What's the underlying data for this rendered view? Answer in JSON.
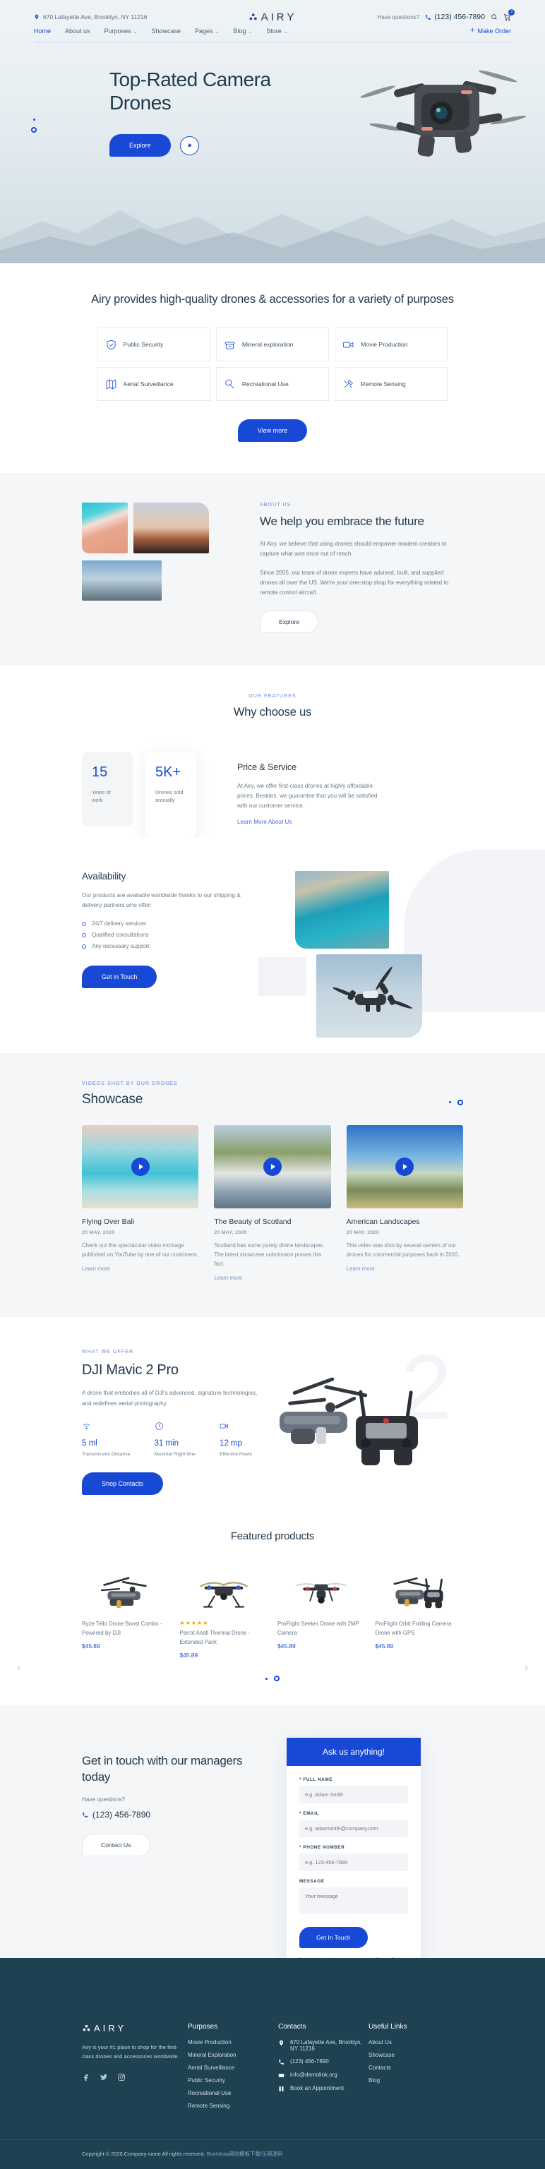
{
  "header": {
    "address": "670 Lafayette Ave, Brooklyn, NY 11216",
    "brand": "AIRY",
    "have_questions": "Have questions?",
    "phone": "(123) 456-7890",
    "cart_count": "3",
    "nav": [
      {
        "label": "Home",
        "caret": false,
        "active": true
      },
      {
        "label": "About us",
        "caret": false,
        "active": false
      },
      {
        "label": "Purposes",
        "caret": true,
        "active": false
      },
      {
        "label": "Showcase",
        "caret": false,
        "active": false
      },
      {
        "label": "Pages",
        "caret": true,
        "active": false
      },
      {
        "label": "Blog",
        "caret": true,
        "active": false
      },
      {
        "label": "Store",
        "caret": true,
        "active": false
      }
    ],
    "make_order": "Make Order"
  },
  "hero": {
    "title": "Top-Rated Camera Drones",
    "explore": "Explore"
  },
  "purposes": {
    "heading": "Airy provides high-quality drones & accessories for a variety of purposes",
    "cards": [
      {
        "label": "Public Security",
        "icon": "shield-icon"
      },
      {
        "label": "Mineral exploration",
        "icon": "mine-icon"
      },
      {
        "label": "Movie Production",
        "icon": "video-camera-icon"
      },
      {
        "label": "Aerial Surveillance",
        "icon": "map-icon"
      },
      {
        "label": "Recreational Use",
        "icon": "racket-icon"
      },
      {
        "label": "Remote Sensing",
        "icon": "tools-icon"
      }
    ],
    "view_more": "View more"
  },
  "about": {
    "eyebrow": "ABOUT US",
    "title": "We help you embrace the future",
    "p1": "At Airy, we believe that using drones should empower modern creators to capture what was once out of reach.",
    "p2": "Since 2005, our team of drone experts have advised, built, and supplied drones all over the US. We're your one-stop shop for everything related to remote control aircraft.",
    "explore": "Explore"
  },
  "features": {
    "eyebrow": "OUR FEATURES",
    "title": "Why choose us",
    "stats": [
      {
        "num": "15",
        "label": "Years of work"
      },
      {
        "num": "5K+",
        "label": "Drones sold annually"
      }
    ],
    "price_title": "Price & Service",
    "price_text": "At Airy, we offer first-class drones at highly affordable prices. Besides, we guarantee that you will be satisfied with our customer service.",
    "price_link": "Learn More About Us"
  },
  "availability": {
    "title": "Availability",
    "text": "Our products are available worldwide thanks to our shipping & delivery partners who offer:",
    "items": [
      "24/7 delivery services",
      "Qualified consultations",
      "Any necessary support"
    ],
    "cta": "Get in Touch"
  },
  "showcase": {
    "eyebrow": "VIDEOS SHOT BY OUR DRONES",
    "title": "Showcase",
    "videos": [
      {
        "title": "Flying Over Bali",
        "date": "20 MAY, 2020",
        "desc": "Check out this spectacular video montage published on YouTube by one of our customers.",
        "link": "Learn more"
      },
      {
        "title": "The Beauty of Scotland",
        "date": "20 MAY, 2020",
        "desc": "Scotland has some purely divine landscapes. The latest showcase submission proves this fact.",
        "link": "Learn more"
      },
      {
        "title": "American Landscapes",
        "date": "20 MAY, 2020",
        "desc": "This video was shot by several owners of our drones for commercial purposes back in 2010.",
        "link": "Learn more"
      }
    ]
  },
  "offer": {
    "eyebrow": "WHAT WE OFFER",
    "title": "DJI Mavic 2 Pro",
    "text": "A drone that embodies all of DJI's advanced, signature technologies, and redefines aerial photography.",
    "specs": [
      {
        "num": "5 ml",
        "label": "Transmission Distance",
        "icon": "signal-icon"
      },
      {
        "num": "31 min",
        "label": "Maximal Flight time",
        "icon": "clock-icon"
      },
      {
        "num": "12 mp",
        "label": "Effective Pixels",
        "icon": "video-camera-icon"
      }
    ],
    "cta": "Shop Contacts",
    "watermark": "2"
  },
  "products": {
    "title": "Featured products",
    "items": [
      {
        "name": "Ryze Tello Drone Boost Combo - Powered by DJI",
        "price": "$45.89",
        "stars": 0
      },
      {
        "name": "Parrot Anafi Thermal Drone - Extended Pack",
        "price": "$45.89",
        "stars": 5
      },
      {
        "name": "ProFlight Seeker Drone with 2MP Camera",
        "price": "$45.89",
        "stars": 0
      },
      {
        "name": "ProFlight Orbit Folding Camera Drone with GPS",
        "price": "$45.89",
        "stars": 0
      }
    ]
  },
  "contact": {
    "title": "Get in touch with our managers today",
    "have_questions": "Have questions?",
    "phone": "(123) 456-7890",
    "cta": "Contact Us",
    "form": {
      "heading": "Ask us anything!",
      "fields": [
        {
          "label": "* FULL NAME",
          "placeholder": "e.g. Adam Smith",
          "type": "text"
        },
        {
          "label": "* EMAIL",
          "placeholder": "e.g. adamsmith@company.com",
          "type": "text"
        },
        {
          "label": "* PHONE NUMBER",
          "placeholder": "e.g. 123-456-7890",
          "type": "text"
        },
        {
          "label": "MESSAGE",
          "placeholder": "Your message",
          "type": "textarea"
        }
      ],
      "submit": "Get In Touch",
      "note_pre": "By clicking the button you agree to the ",
      "note_link1": "Privacy Policy",
      "note_mid": " and ",
      "note_link2": "Terms of Service",
      "note_end": "."
    }
  },
  "footer": {
    "brand": "AIRY",
    "desc": "Airy is your #1 place to shop for the first-class drones and accessories worldwide.",
    "columns": [
      {
        "heading": "Purposes",
        "items": [
          "Movie Production",
          "Mineral Exploration",
          "Aerial Surveillance",
          "Public Security",
          "Recreational Use",
          "Remote Sensing"
        ]
      },
      {
        "heading": "Contacts",
        "items": [
          "670 Lafayette Ave, Brooklyn, NY 11216",
          "(123) 456-7890",
          "info@demolink.org",
          "Book an Appointment"
        ]
      },
      {
        "heading": "Useful Links",
        "items": [
          "About Us",
          "Showcase",
          "Contacts",
          "Blog"
        ]
      }
    ],
    "copyright_pre": "Copyright © 2020.Company name All rights reserved. ",
    "copyright_link": "Bootstrap网站模板下载/乐程源码"
  },
  "colors": {
    "accent": "#1749d6",
    "dark": "#1f4253",
    "ink": "#223a4e",
    "muted": "#6b7c88"
  }
}
